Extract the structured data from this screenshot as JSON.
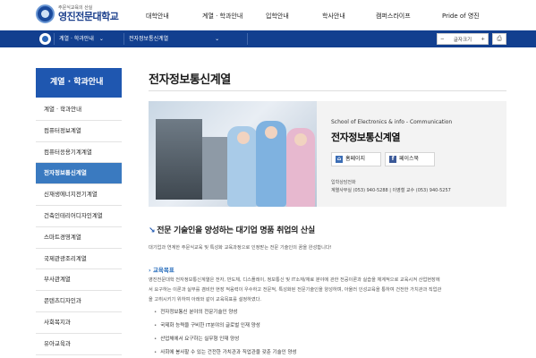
{
  "header": {
    "slogan": "주문식교육의 산실",
    "school_name": "영진전문대학교",
    "nav": [
      "대학안내",
      "계열 · 학과안내",
      "입학안내",
      "학사안내",
      "캠퍼스라이프",
      "Pride of 영진"
    ]
  },
  "subbar": {
    "crumb1": "계열 · 학과안내",
    "crumb2": "전자정보통신계열",
    "chevron": "⌄",
    "font_size_minus": "−",
    "font_size_label": "글자크기",
    "font_size_plus": "+",
    "print_icon": "⎙"
  },
  "sidebar": {
    "title": "계열 · 학과안내",
    "items": [
      {
        "label": "계열 · 학과안내"
      },
      {
        "label": "컴퓨터정보계열"
      },
      {
        "label": "컴퓨터응용기계계열"
      },
      {
        "label": "전자정보통신계열"
      },
      {
        "label": "신재생에너지전기계열"
      },
      {
        "label": "건축인테리어디자인계열"
      },
      {
        "label": "스마트경영계열"
      },
      {
        "label": "국제관광조리계열"
      },
      {
        "label": "부사관계열"
      },
      {
        "label": "콘텐츠디자인과"
      },
      {
        "label": "사회복지과"
      },
      {
        "label": "유아교육과"
      }
    ],
    "active_index": 3
  },
  "main": {
    "title": "전자정보통신계열",
    "info": {
      "name_en": "School of Electronics & info - Communication",
      "name_ko": "전자정보통신계열",
      "homepage_label": "홈페이지",
      "homepage_icon": "⌂",
      "facebook_label": "페이스북",
      "facebook_icon": "f",
      "contact_label": "입학상담전화",
      "contact_text": "계열사무실 (053) 940-5288 | 이영철 교수 (053) 940-5257"
    },
    "slogan_mark": "↘",
    "slogan": "전문 기술인을 양성하는 대기업 명품 취업의 산실",
    "intro": "대기업과 연계한 주문식교육 및 특성화 교육과정으로 인정받는 전문 기술인의 꿈을 완성합니다!",
    "goal_heading": "› 교육목표",
    "goal_lines": [
      "영진전문대학 전자정보통신계열은 전자, 반도체, 디스플레이, 정보통신 및 IT소재/재료 분야에 관한 전공이론과 실습을 체계적으로 교육시켜 산업현장에",
      "서 요구하는 이론과 실무를 겸비한 현장 적응력이 우수하고 전문적, 특성화된 전문기술인을 양성하며, 아울러 인성교육을 통하여 건전한 가치관과 직업관",
      "을 고취시키기 위하여 아래와 같이 교육목표를 설정하였다."
    ],
    "bullets": [
      "전자정보통신 분야의 전문기술인 양성",
      "국제화 능력을 구비한 IT분야의 글로벌 인재 양성",
      "산업체에서 요구하는 실무형 인재 양성",
      "사회에 봉사할 수 있는 건전한 가치관과 직업관을 갖춘 기술인 양성"
    ]
  },
  "colors": {
    "brand_blue": "#123f8f",
    "sidebar_title": "#1f57b0",
    "sidebar_active": "#3a7ac0",
    "accent": "#2a6fbd"
  }
}
